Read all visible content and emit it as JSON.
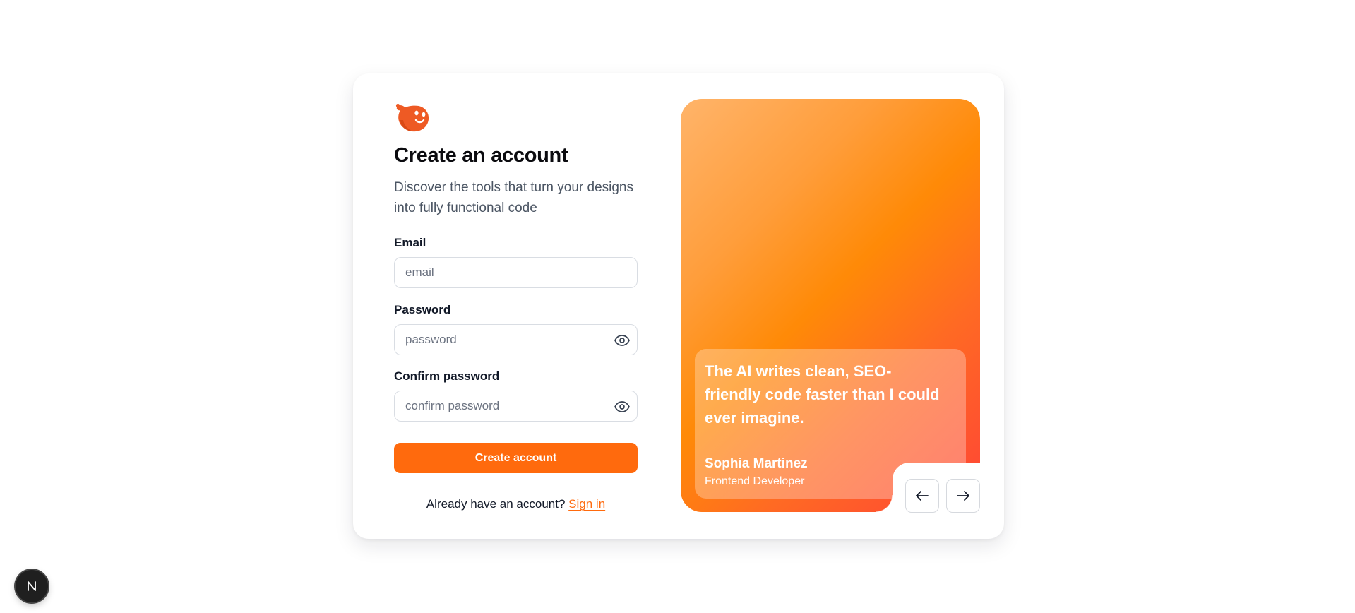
{
  "form": {
    "title": "Create an account",
    "subtitle": "Discover the tools that turn your designs into fully functional code",
    "email": {
      "label": "Email",
      "placeholder": "email"
    },
    "password": {
      "label": "Password",
      "placeholder": "password"
    },
    "confirm_password": {
      "label": "Confirm password",
      "placeholder": "confirm password"
    },
    "submit_label": "Create account",
    "signin_prompt": "Already have an account?",
    "signin_link": "Sign in"
  },
  "testimonial": {
    "quote": "The AI writes clean, SEO-friendly code faster than I could ever imagine.",
    "author": "Sophia Martinez",
    "role": "Frontend Developer"
  },
  "icons": {
    "logo": "mascot-logo-icon",
    "show_password": "eye-icon",
    "previous": "arrow-left-icon",
    "next": "arrow-right-icon",
    "dev_badge": "n-letter-icon"
  },
  "colors": {
    "accent": "#ff6a0d",
    "gradient": [
      "#ffb46a",
      "#ff8a07",
      "#ff4436"
    ]
  }
}
